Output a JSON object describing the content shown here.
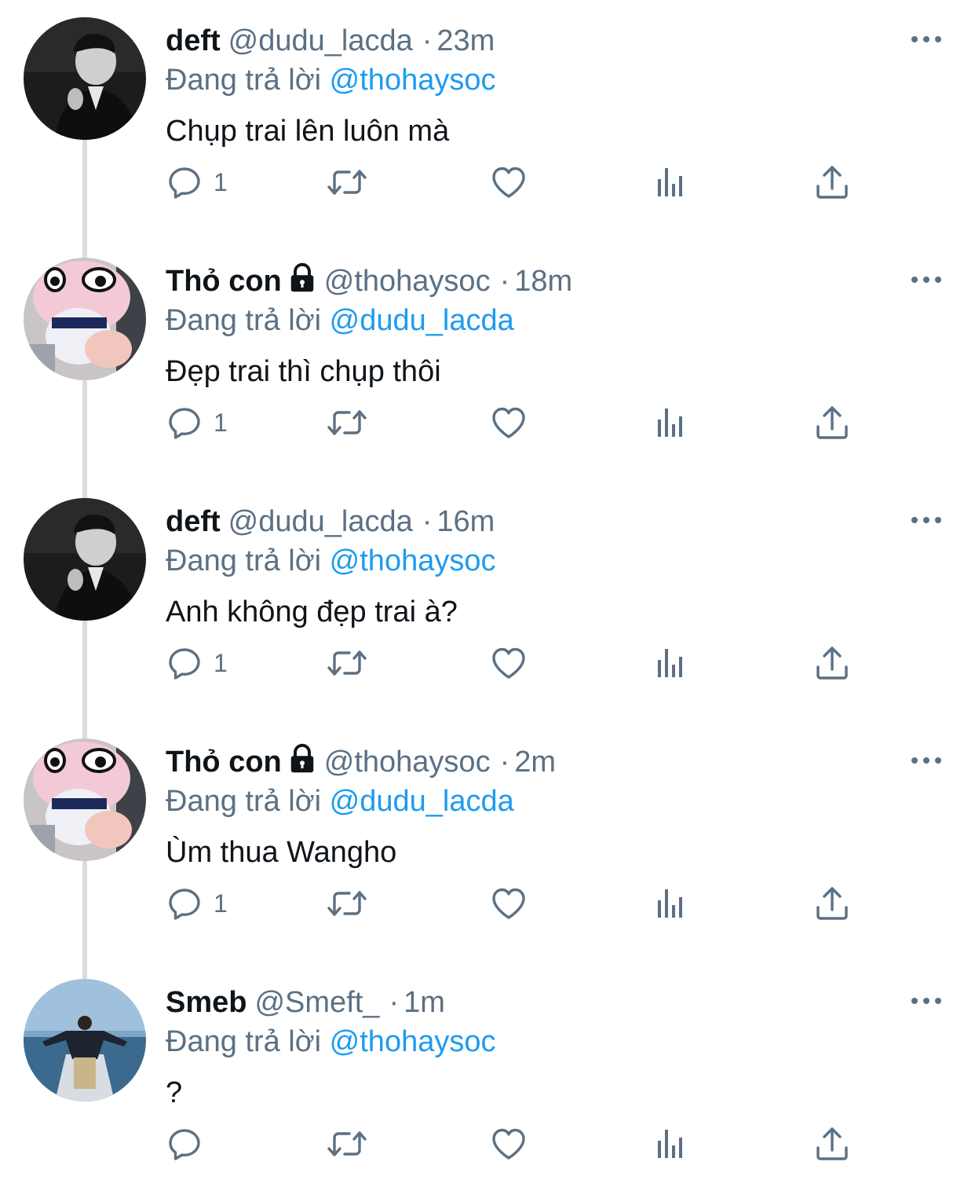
{
  "replying_prefix": "Đang trả lời",
  "tweets": [
    {
      "name": "deft",
      "locked": false,
      "handle": "@dudu_lacda",
      "time": "23m",
      "reply_to": "@thohaysoc",
      "text": "Chụp trai lên luôn mà",
      "reply_count": "1",
      "avatar": "dark-portrait"
    },
    {
      "name": "Thỏ con",
      "locked": true,
      "handle": "@thohaysoc",
      "time": "18m",
      "reply_to": "@dudu_lacda",
      "text": "Đẹp trai thì chụp thôi",
      "reply_count": "1",
      "avatar": "pink-plush"
    },
    {
      "name": "deft",
      "locked": false,
      "handle": "@dudu_lacda",
      "time": "16m",
      "reply_to": "@thohaysoc",
      "text": "Anh không đẹp trai à?",
      "reply_count": "1",
      "avatar": "dark-portrait"
    },
    {
      "name": "Thỏ con",
      "locked": true,
      "handle": "@thohaysoc",
      "time": "2m",
      "reply_to": "@dudu_lacda",
      "text": "Ùm thua Wangho",
      "reply_count": "1",
      "avatar": "pink-plush"
    },
    {
      "name": "Smeb",
      "locked": false,
      "handle": "@Smeft_",
      "time": "1m",
      "reply_to": "@thohaysoc",
      "text": "?",
      "reply_count": "",
      "avatar": "sea-photo"
    }
  ],
  "colors": {
    "name": "#0f1419",
    "secondary": "#5b7083",
    "mention": "#1d9bf0",
    "thread_line": "#d9dde1"
  }
}
